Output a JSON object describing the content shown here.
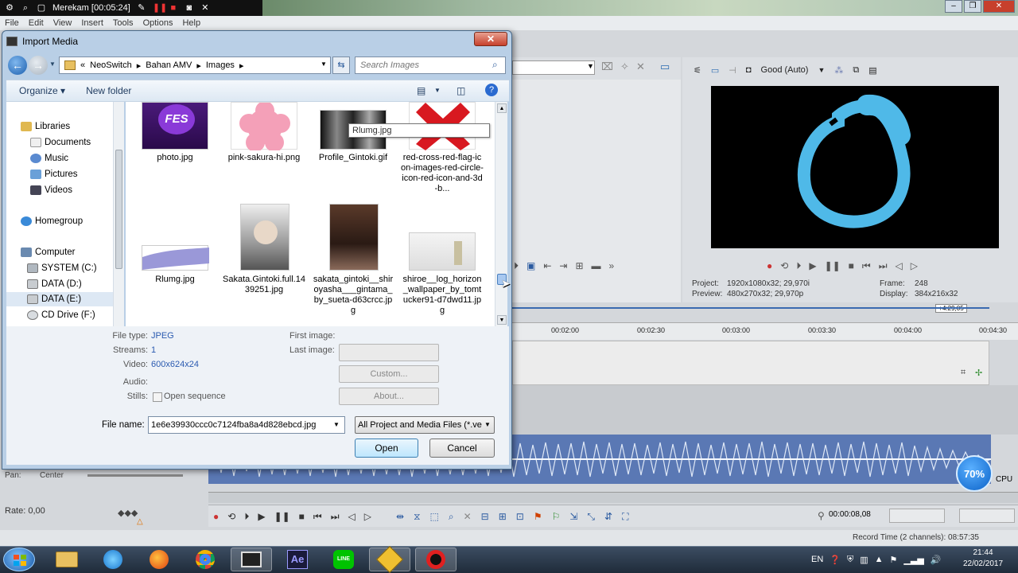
{
  "recorder": {
    "title": "Merekam [00:05:24]"
  },
  "menu": [
    "File",
    "Edit",
    "View",
    "Insert",
    "Tools",
    "Options",
    "Help"
  ],
  "preview": {
    "quality": "Good (Auto)",
    "project_label": "Project:",
    "project_value": "1920x1080x32; 29,970i",
    "preview_label": "Preview:",
    "preview_value": "480x270x32; 29,970p",
    "frame_label": "Frame:",
    "frame_value": "248",
    "display_label": "Display:",
    "display_value": "384x216x32"
  },
  "timeline": {
    "ticks": [
      "00:02:00",
      "00:02:30",
      "00:03:00",
      "00:03:30",
      "00:04:00",
      "00:04:30"
    ],
    "marker": "+4:29,05",
    "pan_label": "Pan:",
    "pan_value": "Center",
    "rate_label": "Rate: 0,00",
    "timecode": "00:00:08,08",
    "record_time": "Record Time (2 channels): 08:57:35"
  },
  "cpu": {
    "value": "70%",
    "label": "CPU"
  },
  "dialog": {
    "title": "Import Media",
    "path": [
      "«",
      "NeoSwitch",
      "Bahan AMV",
      "Images"
    ],
    "search_placeholder": "Search Images",
    "organize": "Organize ▾",
    "new_folder": "New folder",
    "nav": {
      "libraries": "Libraries",
      "documents": "Documents",
      "music": "Music",
      "pictures": "Pictures",
      "videos": "Videos",
      "homegroup": "Homegroup",
      "computer": "Computer",
      "system": "SYSTEM (C:)",
      "data_d": "DATA (D:)",
      "data_e": "DATA (E:)",
      "cd": "CD Drive (F:)"
    },
    "files": [
      {
        "name": "photo.jpg",
        "thumb_text": "FES"
      },
      {
        "name": "pink-sakura-hi.png"
      },
      {
        "name": "Profile_Gintoki.gif"
      },
      {
        "name": "red-cross-red-flag-icon-images-red-circle-icon-red-icon-and-3d-b..."
      },
      {
        "name": "Rlumg.jpg"
      },
      {
        "name": "Sakata.Gintoki.full.1439251.jpg"
      },
      {
        "name": "sakata_gintoki__shiroyasha___gintama_by_sueta-d63crcc.jpg"
      },
      {
        "name": "shiroe__log_horizon_wallpaper_by_tomtucker91-d7dwd11.jpg"
      }
    ],
    "tooltip": "Rlumg.jpg",
    "details": {
      "file_type_label": "File type:",
      "file_type": "JPEG",
      "streams_label": "Streams:",
      "streams": "1",
      "video_label": "Video:",
      "video": "600x624x24",
      "audio_label": "Audio:",
      "stills_label": "Stills:",
      "open_sequence": "Open sequence",
      "first_image_label": "First image:",
      "last_image_label": "Last image:",
      "custom_btn": "Custom...",
      "about_btn": "About..."
    },
    "file_name_label": "File name:",
    "file_name": "1e6e39930ccc0c7124fba8a4d828ebcd.jpg",
    "file_type_filter": "All Project and Media Files (*.ve",
    "open": "Open",
    "cancel": "Cancel"
  },
  "taskbar": {
    "lang": "EN",
    "time": "21:44",
    "date": "22/02/2017",
    "ae_label": "Ae",
    "line_label": "LINE"
  }
}
